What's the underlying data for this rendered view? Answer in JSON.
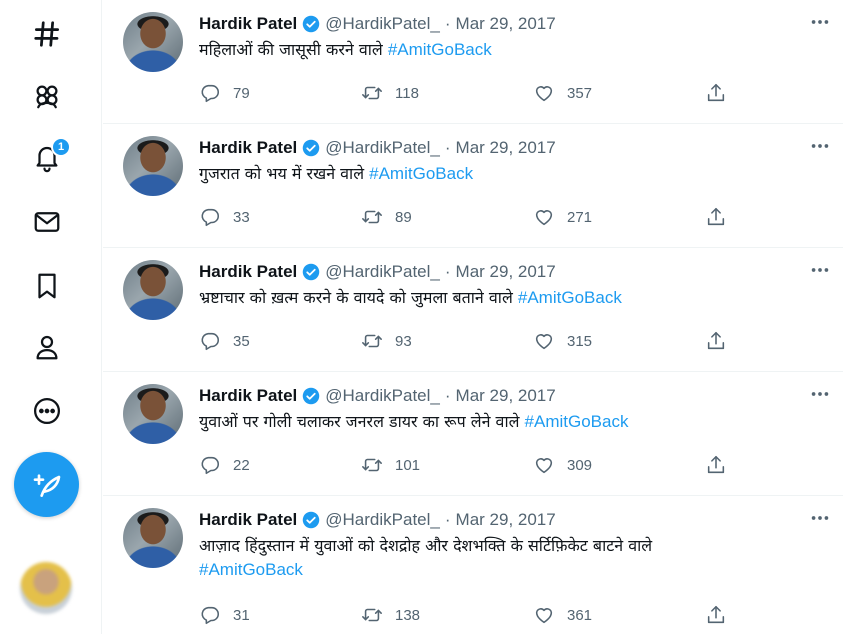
{
  "nav": {
    "items": [
      {
        "icon": "hashtag-icon",
        "label": "Explore"
      },
      {
        "icon": "communities-icon",
        "label": "Communities"
      },
      {
        "icon": "bell-icon",
        "label": "Notifications"
      },
      {
        "icon": "mail-icon",
        "label": "Messages"
      },
      {
        "icon": "bookmark-icon",
        "label": "Bookmarks"
      },
      {
        "icon": "profile-icon",
        "label": "Profile"
      },
      {
        "icon": "more-circle-icon",
        "label": "More"
      }
    ],
    "notification_badge": "1",
    "compose_icon": "feather-plus-icon"
  },
  "tweets": [
    {
      "name": "Hardik Patel",
      "handle": "@HardikPatel_",
      "separator": "·",
      "date": "Mar 29, 2017",
      "text": "महिलाओं की जासूसी करने वाले",
      "hashtag": "#AmitGoBack",
      "replies": "79",
      "retweets": "118",
      "likes": "357"
    },
    {
      "name": "Hardik Patel",
      "handle": "@HardikPatel_",
      "separator": "·",
      "date": "Mar 29, 2017",
      "text": "गुजरात को भय में रखने वाले",
      "hashtag": "#AmitGoBack",
      "replies": "33",
      "retweets": "89",
      "likes": "271"
    },
    {
      "name": "Hardik Patel",
      "handle": "@HardikPatel_",
      "separator": "·",
      "date": "Mar 29, 2017",
      "text": "भ्रष्टाचार को ख़त्म करने के वायदे को जुमला बताने वाले",
      "hashtag": "#AmitGoBack",
      "replies": "35",
      "retweets": "93",
      "likes": "315"
    },
    {
      "name": "Hardik Patel",
      "handle": "@HardikPatel_",
      "separator": "·",
      "date": "Mar 29, 2017",
      "text": "युवाओं पर गोली चलाकर जनरल डायर का रूप लेने वाले",
      "hashtag": "#AmitGoBack",
      "replies": "22",
      "retweets": "101",
      "likes": "309"
    },
    {
      "name": "Hardik Patel",
      "handle": "@HardikPatel_",
      "separator": "·",
      "date": "Mar 29, 2017",
      "text": "आज़ाद हिंदुस्तान में युवाओं को देशद्रोह और देशभक्ति के सर्टिफ़िकेट बाटने वाले",
      "hashtag": "#AmitGoBack",
      "replies": "31",
      "retweets": "138",
      "likes": "361"
    }
  ],
  "colors": {
    "accent": "#1d9bf0",
    "text": "#0f1419",
    "muted": "#536471",
    "divider": "#eff3f4"
  }
}
